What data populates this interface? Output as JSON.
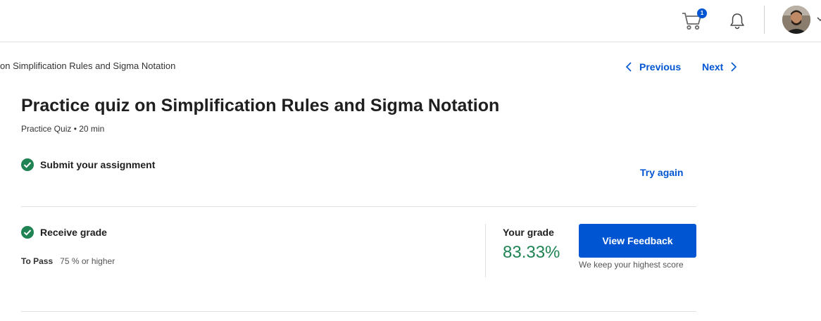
{
  "header": {
    "cart_badge": "1",
    "cart_icon": "cart-icon",
    "bell_icon": "bell-icon",
    "avatar_icon": "avatar"
  },
  "breadcrumb": "on Simplification Rules and Sigma Notation",
  "nav": {
    "previous": "Previous",
    "next": "Next"
  },
  "quiz": {
    "title": "Practice quiz on Simplification Rules and Sigma Notation",
    "subtitle": "Practice Quiz • 20 min"
  },
  "steps": {
    "submit_label": "Submit your assignment",
    "try_again": "Try again",
    "receive_label": "Receive grade",
    "to_pass_label": "To Pass",
    "to_pass_value": "75 % or higher"
  },
  "grade": {
    "label": "Your grade",
    "value": "83.33%",
    "feedback_button": "View Feedback",
    "note": "We keep your highest score"
  },
  "colors": {
    "accent": "#0056d2",
    "success": "#1f8354",
    "text": "#1f1f1f"
  }
}
